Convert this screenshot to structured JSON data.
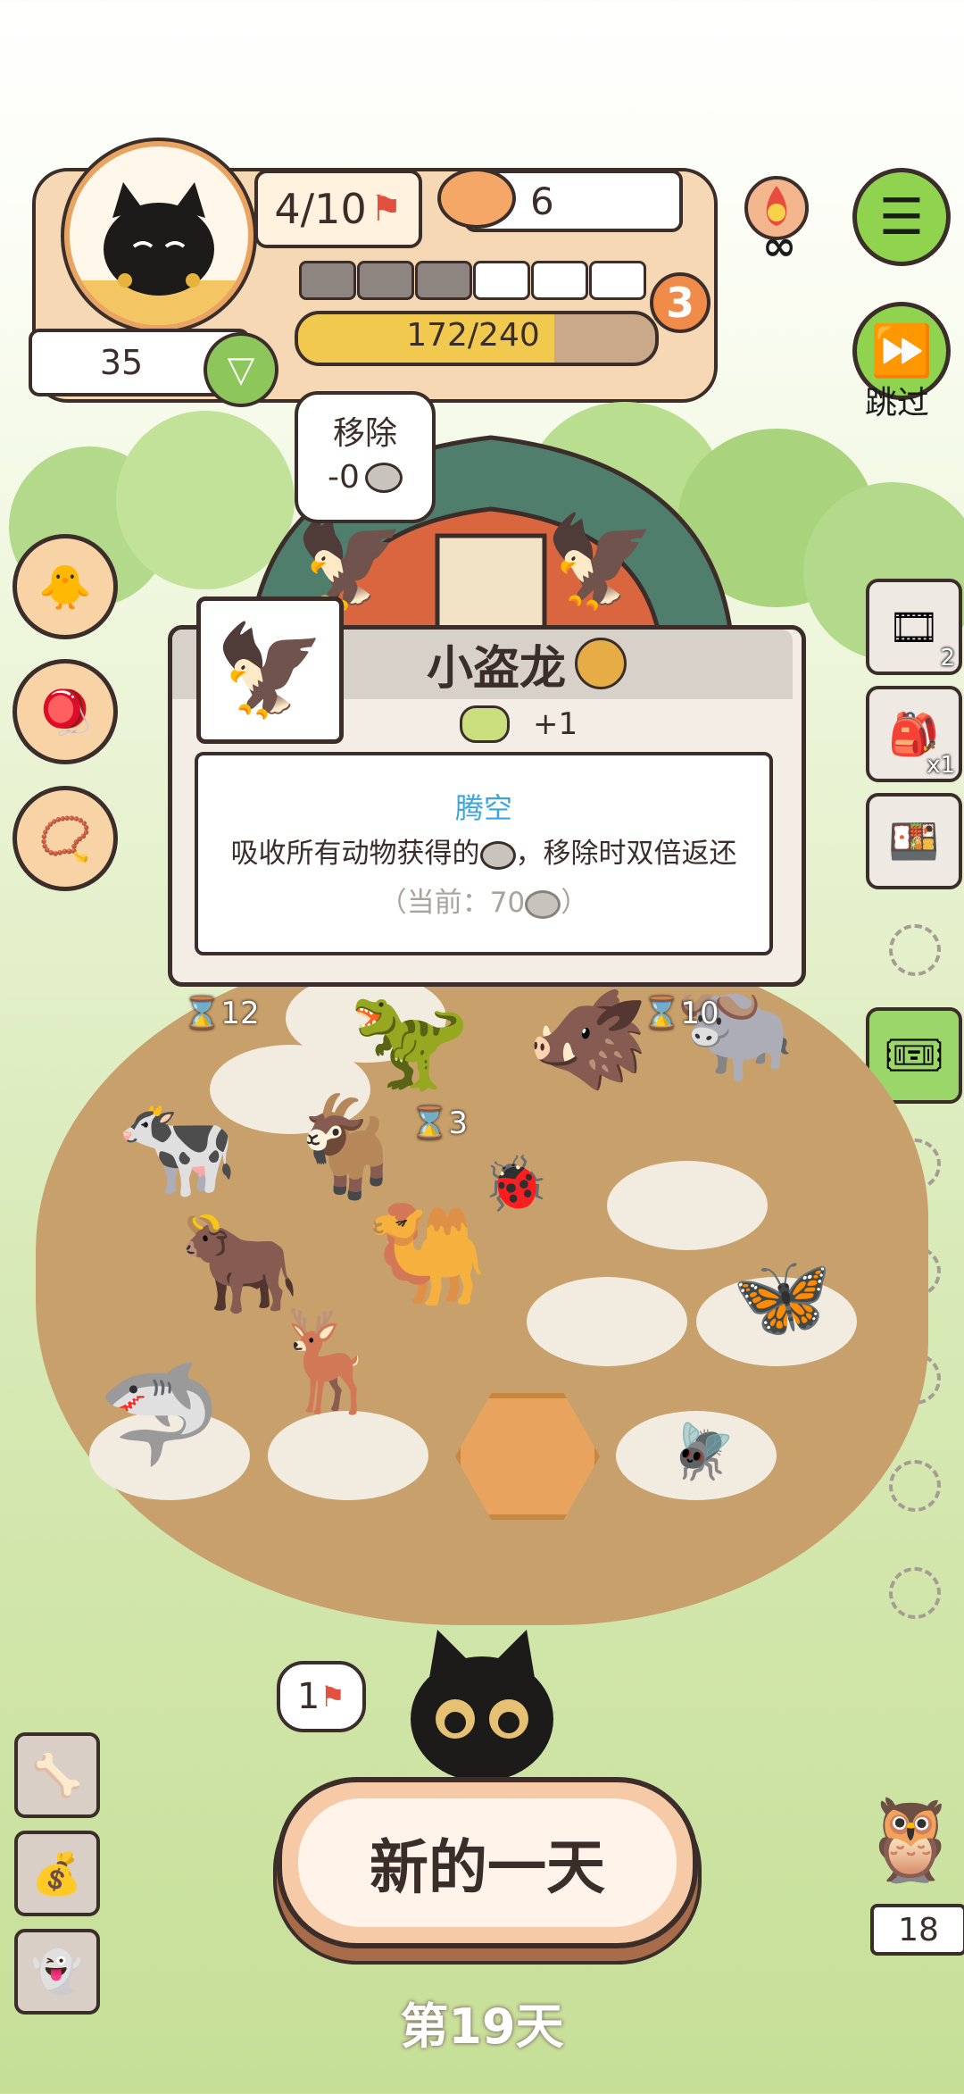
{
  "hud": {
    "flags": "4/10",
    "coins": "6",
    "level": "3",
    "xp_text": "172/240",
    "xp_fraction": 0.717,
    "health": "35",
    "progress_segments_filled": 3,
    "progress_segments_total": 6
  },
  "menu": {
    "skip_label": "跳过",
    "infinite_symbol": "∞"
  },
  "remove_bubble": {
    "title": "移除",
    "cost": "-0"
  },
  "dialog": {
    "animal_name": "小盗龙",
    "bonus": "+1",
    "skill_name": "腾空",
    "skill_desc_part1": "吸收所有动物获得的",
    "skill_desc_part2": "，移除时双倍返还",
    "current_prefix": "（当前：70",
    "current_suffix": "）"
  },
  "timers": {
    "left": "12",
    "goat": "3",
    "ox": "10"
  },
  "right_slots": [
    {
      "icon": "reel-icon",
      "count": "2"
    },
    {
      "icon": "backpack-icon",
      "count": "x1"
    },
    {
      "icon": "food-box-icon",
      "count": ""
    }
  ],
  "bottom": {
    "flag_count": "1",
    "new_day": "新的一天",
    "day_label": "第19天",
    "owl_count": "18"
  }
}
